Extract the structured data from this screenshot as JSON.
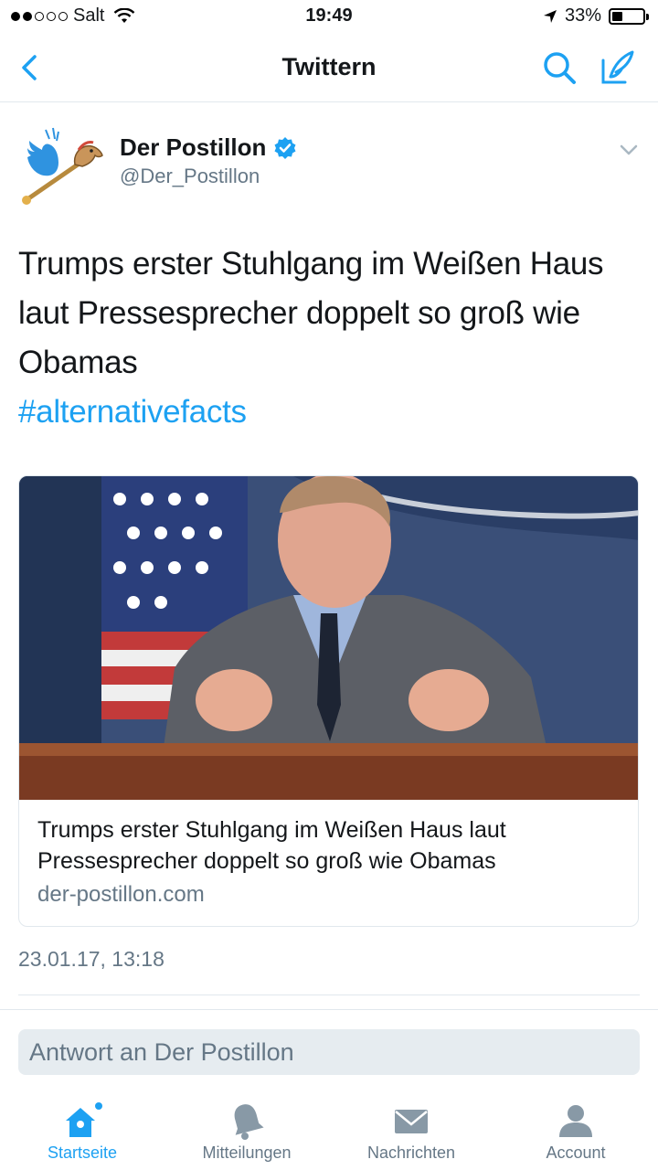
{
  "status_bar": {
    "carrier": "Salt",
    "time": "19:49",
    "battery": "33%",
    "battery_level": 0.33
  },
  "nav": {
    "title": "Twittern",
    "icons": [
      "back-chevron-icon",
      "search-icon",
      "compose-icon"
    ]
  },
  "tweet": {
    "author_name": "Der Postillon",
    "author_handle": "@Der_Postillon",
    "text": "Trumps erster Stuhlgang im Weißen Haus laut Pressesprecher doppelt so groß wie Obamas",
    "hashtag": "#alternativefacts",
    "timestamp": "23.01.17, 13:18"
  },
  "card": {
    "title": "Trumps erster Stuhlgang im Weißen Haus laut Pressesprecher doppelt so groß wie Obamas",
    "domain": "der-postillon.com"
  },
  "reply": {
    "placeholder": "Antwort an Der Postillon"
  },
  "tabbar": {
    "items": [
      {
        "label": "Startseite",
        "icon": "home-icon",
        "active": true
      },
      {
        "label": "Mitteilungen",
        "icon": "bell-icon",
        "active": false
      },
      {
        "label": "Nachrichten",
        "icon": "envelope-icon",
        "active": false
      },
      {
        "label": "Account",
        "icon": "person-icon",
        "active": false
      }
    ]
  },
  "colors": {
    "accent": "#1da1f2",
    "secondary_text": "#657786",
    "reply_bg": "#e6ecf0"
  }
}
